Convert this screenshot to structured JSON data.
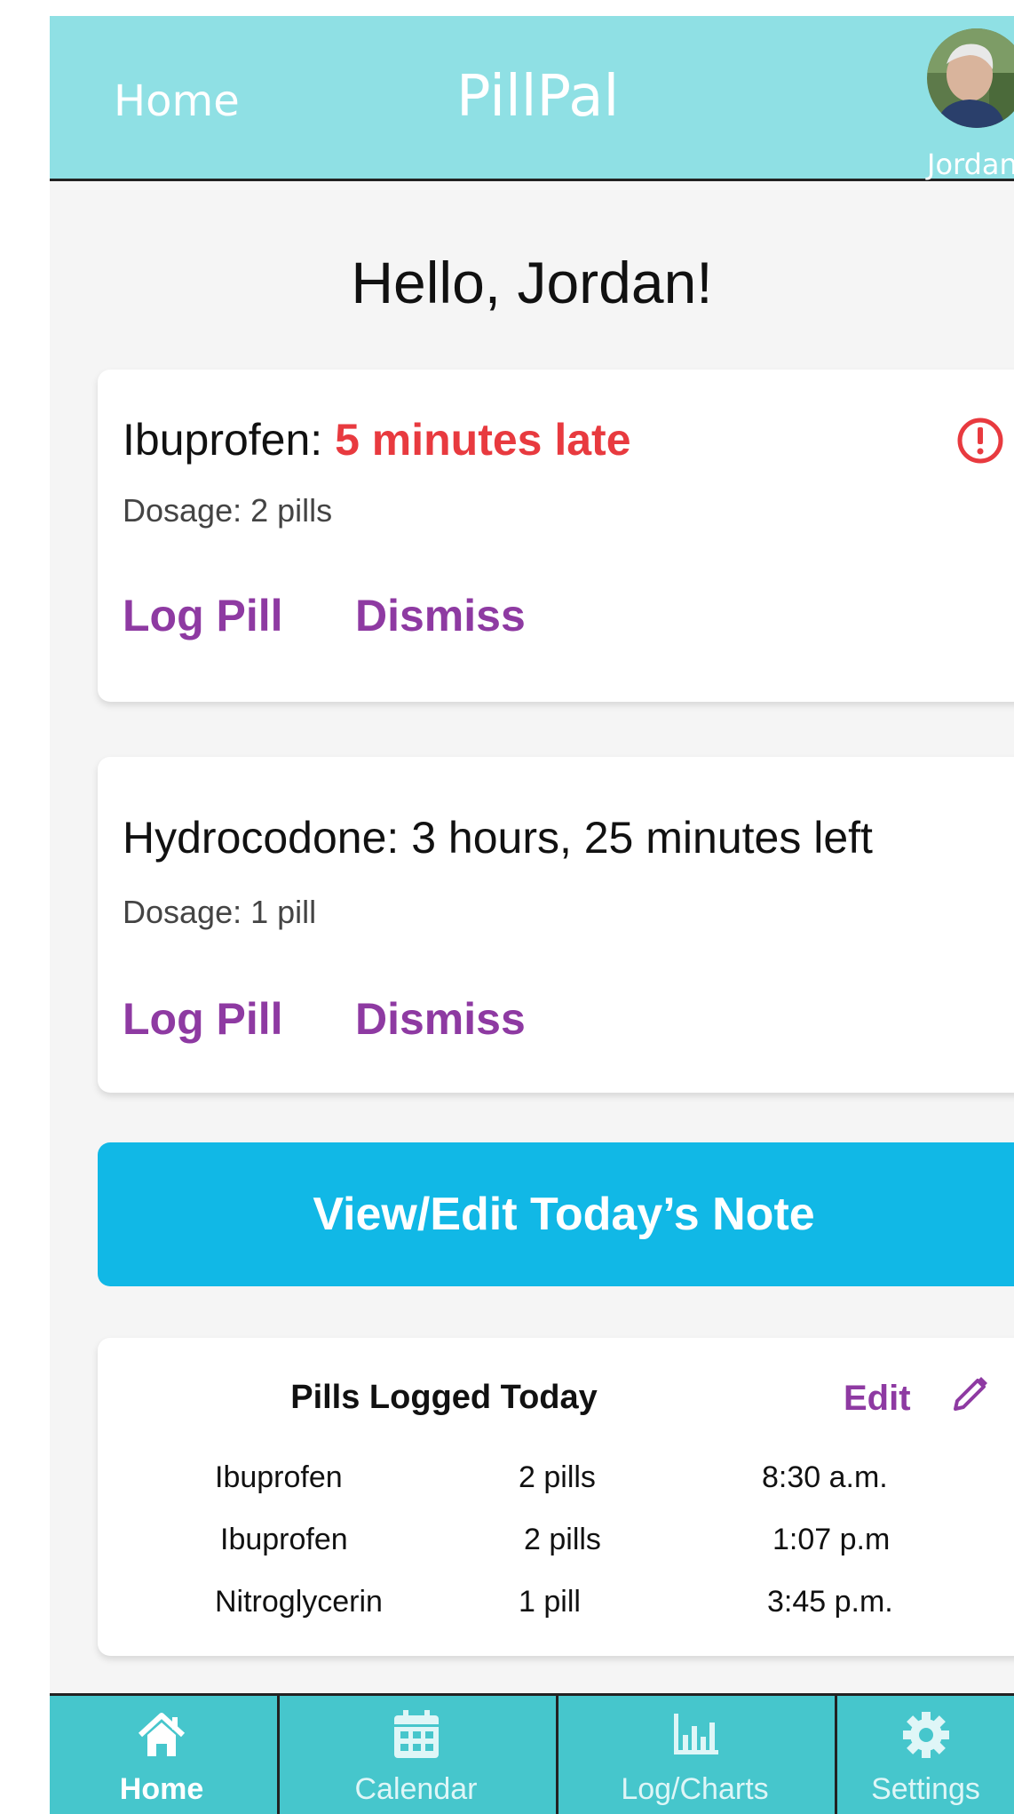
{
  "header": {
    "nav_home": "Home",
    "title": "PillPal",
    "user_name": "Jordan",
    "avatar_icon": "user-avatar-photo"
  },
  "greeting": "Hello, Jordan!",
  "reminders": [
    {
      "name": "Ibuprofen: ",
      "status": "5 minutes late",
      "status_color": "#e83a3f",
      "dosage": "Dosage: 2 pills",
      "log_label": "Log Pill",
      "dismiss_label": "Dismiss",
      "icon": "alert-circle-icon"
    },
    {
      "name": "Hydrocodone: 3 hours, 25 minutes left",
      "dosage": "Dosage: 1 pill",
      "log_label": "Log Pill",
      "dismiss_label": "Dismiss"
    }
  ],
  "note_button": "View/Edit Today’s Note",
  "log": {
    "title": "Pills Logged Today",
    "edit_label": "Edit",
    "edit_icon": "pencil-icon",
    "rows": [
      {
        "medication": "Ibuprofen",
        "dose": "2 pills",
        "time": "8:30 a.m."
      },
      {
        "medication": "Ibuprofen",
        "dose": "2 pills",
        "time": "1:07 p.m"
      },
      {
        "medication": "Nitroglycerin",
        "dose": "1 pill",
        "time": "3:45 p.m."
      }
    ]
  },
  "bottom_nav": [
    {
      "label": "Home",
      "icon": "home-icon",
      "active": true
    },
    {
      "label": "Calendar",
      "icon": "calendar-icon",
      "active": false
    },
    {
      "label": "Log/Charts",
      "icon": "bar-chart-icon",
      "active": false
    },
    {
      "label": "Settings",
      "icon": "gear-icon",
      "active": false
    }
  ],
  "colors": {
    "header_bg": "#8fe0e4",
    "nav_bg": "#46c6cc",
    "accent_purple": "#8e3aa2",
    "alert_red": "#e83a3f",
    "note_button_bg": "#11b8e6"
  }
}
